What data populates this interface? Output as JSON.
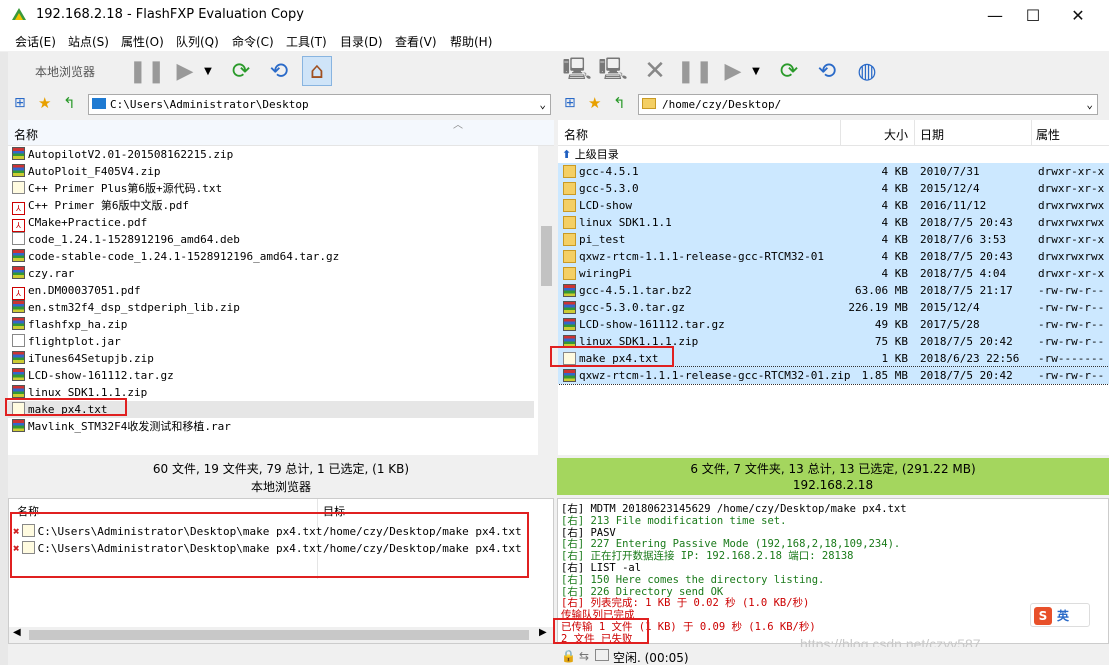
{
  "window": {
    "title": "192.168.2.18 - FlashFXP Evaluation Copy"
  },
  "menu": [
    "会话(E)",
    "站点(S)",
    "属性(O)",
    "队列(Q)",
    "命令(C)",
    "工具(T)",
    "目录(D)",
    "查看(V)",
    "帮助(H)"
  ],
  "left": {
    "toolbar_label": "本地浏览器",
    "path": "C:\\Users\\Administrator\\Desktop",
    "col_name": "名称",
    "files": [
      {
        "name": "AutopilotV2.01-201508162215.zip",
        "icon": "zip"
      },
      {
        "name": "AutoPloit_F405V4.zip",
        "icon": "zip"
      },
      {
        "name": "C++ Primer Plus第6版+源代码.txt",
        "icon": "txt"
      },
      {
        "name": "C++ Primer 第6版中文版.pdf",
        "icon": "pdf"
      },
      {
        "name": "CMake+Practice.pdf",
        "icon": "pdf"
      },
      {
        "name": "code_1.24.1-1528912196_amd64.deb",
        "icon": "doc"
      },
      {
        "name": "code-stable-code_1.24.1-1528912196_amd64.tar.gz",
        "icon": "zip"
      },
      {
        "name": "czy.rar",
        "icon": "zip"
      },
      {
        "name": "en.DM00037051.pdf",
        "icon": "pdf"
      },
      {
        "name": "en.stm32f4_dsp_stdperiph_lib.zip",
        "icon": "zip"
      },
      {
        "name": "flashfxp_ha.zip",
        "icon": "zip"
      },
      {
        "name": "flightplot.jar",
        "icon": "doc"
      },
      {
        "name": "iTunes64Setupjb.zip",
        "icon": "zip"
      },
      {
        "name": "LCD-show-161112.tar.gz",
        "icon": "zip"
      },
      {
        "name": "linux SDK1.1.1.zip",
        "icon": "zip"
      },
      {
        "name": "make px4.txt",
        "icon": "txt"
      },
      {
        "name": "Mavlink_STM32F4收发测试和移植.rar",
        "icon": "zip"
      }
    ],
    "status": "60 文件, 19 文件夹, 79 总计, 1 已选定, (1 KB)",
    "status_label": "本地浏览器"
  },
  "right": {
    "path": "/home/czy/Desktop/",
    "cols": {
      "name": "名称",
      "size": "大小",
      "date": "日期",
      "attr": "属性"
    },
    "parent": "上级目录",
    "files": [
      {
        "name": "gcc-4.5.1",
        "size": "4 KB",
        "date": "2010/7/31",
        "attr": "drwxr-xr-x",
        "icon": "folder"
      },
      {
        "name": "gcc-5.3.0",
        "size": "4 KB",
        "date": "2015/12/4",
        "attr": "drwxr-xr-x",
        "icon": "folder"
      },
      {
        "name": "LCD-show",
        "size": "4 KB",
        "date": "2016/11/12",
        "attr": "drwxrwxrwx",
        "icon": "folder"
      },
      {
        "name": "linux SDK1.1.1",
        "size": "4 KB",
        "date": "2018/7/5 20:43",
        "attr": "drwxrwxrwx",
        "icon": "folder"
      },
      {
        "name": "pi_test",
        "size": "4 KB",
        "date": "2018/7/6 3:53",
        "attr": "drwxr-xr-x",
        "icon": "folder"
      },
      {
        "name": "qxwz-rtcm-1.1.1-release-gcc-RTCM32-01",
        "size": "4 KB",
        "date": "2018/7/5 20:43",
        "attr": "drwxrwxrwx",
        "icon": "folder"
      },
      {
        "name": "wiringPi",
        "size": "4 KB",
        "date": "2018/7/5 4:04",
        "attr": "drwxr-xr-x",
        "icon": "folder"
      },
      {
        "name": "gcc-4.5.1.tar.bz2",
        "size": "63.06 MB",
        "date": "2018/7/5 21:17",
        "attr": "-rw-rw-r--",
        "icon": "zip"
      },
      {
        "name": "gcc-5.3.0.tar.gz",
        "size": "226.19 MB",
        "date": "2015/12/4",
        "attr": "-rw-rw-r--",
        "icon": "zip"
      },
      {
        "name": "LCD-show-161112.tar.gz",
        "size": "49 KB",
        "date": "2017/5/28",
        "attr": "-rw-rw-r--",
        "icon": "zip"
      },
      {
        "name": "linux SDK1.1.1.zip",
        "size": "75 KB",
        "date": "2018/7/5 20:42",
        "attr": "-rw-rw-r--",
        "icon": "zip"
      },
      {
        "name": "make px4.txt",
        "size": "1 KB",
        "date": "2018/6/23 22:56",
        "attr": "-rw-------",
        "icon": "txt"
      },
      {
        "name": "qxwz-rtcm-1.1.1-release-gcc-RTCM32-01.zip",
        "size": "1.85 MB",
        "date": "2018/7/5 20:42",
        "attr": "-rw-rw-r--",
        "icon": "zip"
      }
    ],
    "status": "6 文件, 7 文件夹, 13 总计, 13 已选定, (291.22 MB)",
    "status_label": "192.168.2.18"
  },
  "queue": {
    "col_name": "名称",
    "col_target": "目标",
    "items": [
      {
        "name": "C:\\Users\\Administrator\\Desktop\\make px4.txt",
        "target": "/home/czy/Desktop/make px4.txt"
      },
      {
        "name": "C:\\Users\\Administrator\\Desktop\\make px4.txt",
        "target": "/home/czy/Desktop/make px4.txt"
      }
    ]
  },
  "log": [
    {
      "text": "[右] MDTM 20180623145629 /home/czy/Desktop/make px4.txt",
      "color": "k"
    },
    {
      "text": "[右] 213 File modification time set.",
      "color": "g"
    },
    {
      "text": "[右] PASV",
      "color": "k"
    },
    {
      "text": "[右] 227 Entering Passive Mode (192,168,2,18,109,234).",
      "color": "g"
    },
    {
      "text": "[右] 正在打开数据连接 IP: 192.168.2.18 端口: 28138",
      "color": "g"
    },
    {
      "text": "[右] LIST -al",
      "color": "k"
    },
    {
      "text": "[右] 150 Here comes the directory listing.",
      "color": "g"
    },
    {
      "text": "[右] 226 Directory send OK",
      "color": "g"
    },
    {
      "text": "[右] 列表完成: 1 KB 于 0.02 秒 (1.0 KB/秒)",
      "color": "r"
    },
    {
      "text": "传输队列已完成",
      "color": "r"
    },
    {
      "text": "已传输 1 文件 (1 KB) 于 0.09 秒 (1.6 KB/秒)",
      "color": "r"
    },
    {
      "text": "2 文件 已失败",
      "color": "r"
    }
  ],
  "bottom_status": "空闲. (00:05)",
  "watermark": "https://blog.csdn.net/czyv587",
  "ime_label": "英"
}
